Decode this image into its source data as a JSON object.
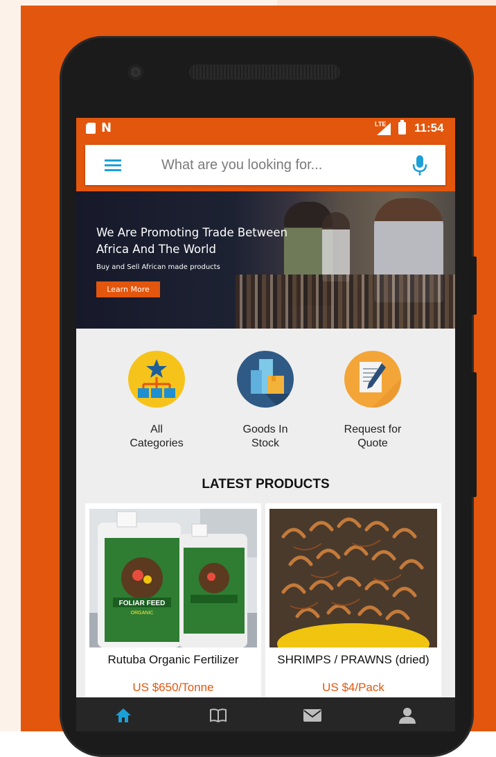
{
  "status_bar": {
    "time": "11:54",
    "network_label": "LTE",
    "notification_letter": "N"
  },
  "search": {
    "placeholder": "What are you looking for..."
  },
  "banner": {
    "title": "We Are Promoting Trade Between Africa And The World",
    "subtitle": "Buy and Sell African made products",
    "button_label": "Learn More"
  },
  "categories": [
    {
      "label": "All Categories",
      "icon": "hierarchy-star-icon",
      "color": "#f6c31a"
    },
    {
      "label": "Goods In Stock",
      "icon": "stacked-boxes-icon",
      "color": "#2f5a86"
    },
    {
      "label": "Request for Quote",
      "icon": "document-pen-icon",
      "color": "#f3a637"
    }
  ],
  "latest": {
    "title": "LATEST PRODUCTS",
    "products": [
      {
        "name": "Rutuba Organic Fertilizer",
        "price": "US $650/Tonne",
        "label_text": "FOLIAR FEED",
        "label_sub": "ORGANIC"
      },
      {
        "name": "SHRIMPS / PRAWNS (dried)",
        "price": "US $4/Pack"
      }
    ]
  },
  "bottom_nav": [
    {
      "icon": "home-icon",
      "active": true
    },
    {
      "icon": "book-icon",
      "active": false
    },
    {
      "icon": "mail-icon",
      "active": false
    },
    {
      "icon": "person-icon",
      "active": false
    }
  ],
  "colors": {
    "brand_orange": "#e3560d",
    "accent_blue": "#1ca0d8"
  }
}
